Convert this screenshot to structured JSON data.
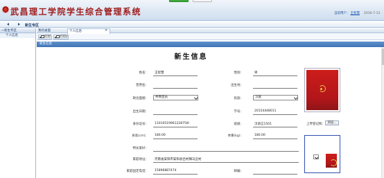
{
  "header": {
    "system_title": "武昌理工学院学生综合管理系统",
    "user_prefix": "当前用户：",
    "user_name": "王智慧",
    "date": "2016-7-13"
  },
  "nav": {
    "crumb": "新生专区"
  },
  "sidebar": {
    "section_label": "新生专区",
    "items": [
      {
        "label": "个人信息"
      }
    ]
  },
  "tabs": [
    {
      "label": "我的桌面"
    },
    {
      "label": "个人信息"
    }
  ],
  "toolbar": {
    "print_label": "打印",
    "print2_label": "打印2"
  },
  "panel": {
    "title": "新生信息"
  },
  "form": {
    "title": "新生信息",
    "name_label": "姓名：",
    "name_value": "王智慧",
    "gender_label": "性别：",
    "gender_value": "男",
    "former_name_label": "曾用名：",
    "former_name_value": "",
    "birthplace_label": "出生地：",
    "birthplace_value": "",
    "political_label": "政治面貌：",
    "political_value": "共青团员",
    "ethnicity_label": "民族：",
    "ethnicity_value": "汉族",
    "birthdate_label": "出生日期：",
    "birthdate_value": "",
    "student_id_label": "学号：",
    "student_id_value": "20154448011",
    "id_card_label": "身份证号：",
    "id_card_value": "1101051996122875l0",
    "class_label": "班级：",
    "class_value": "汉语言1501",
    "height_label": "身高(cm)：",
    "height_value": "180.00",
    "weight_label": "体重(kg)：",
    "weight_value": "180.00",
    "hobby_label": "特长爱好：",
    "hobby_value": "",
    "address_label": "家庭地址：",
    "address_value": "河南省安阳市安阳县吕村镇马庄村",
    "phone_label": "家庭固定电话：",
    "phone_value": "15896887474",
    "postcode_label": "邮编：",
    "postcode_value": "",
    "upload_label": "上传登记照：",
    "browse_label": "浏览..."
  }
}
